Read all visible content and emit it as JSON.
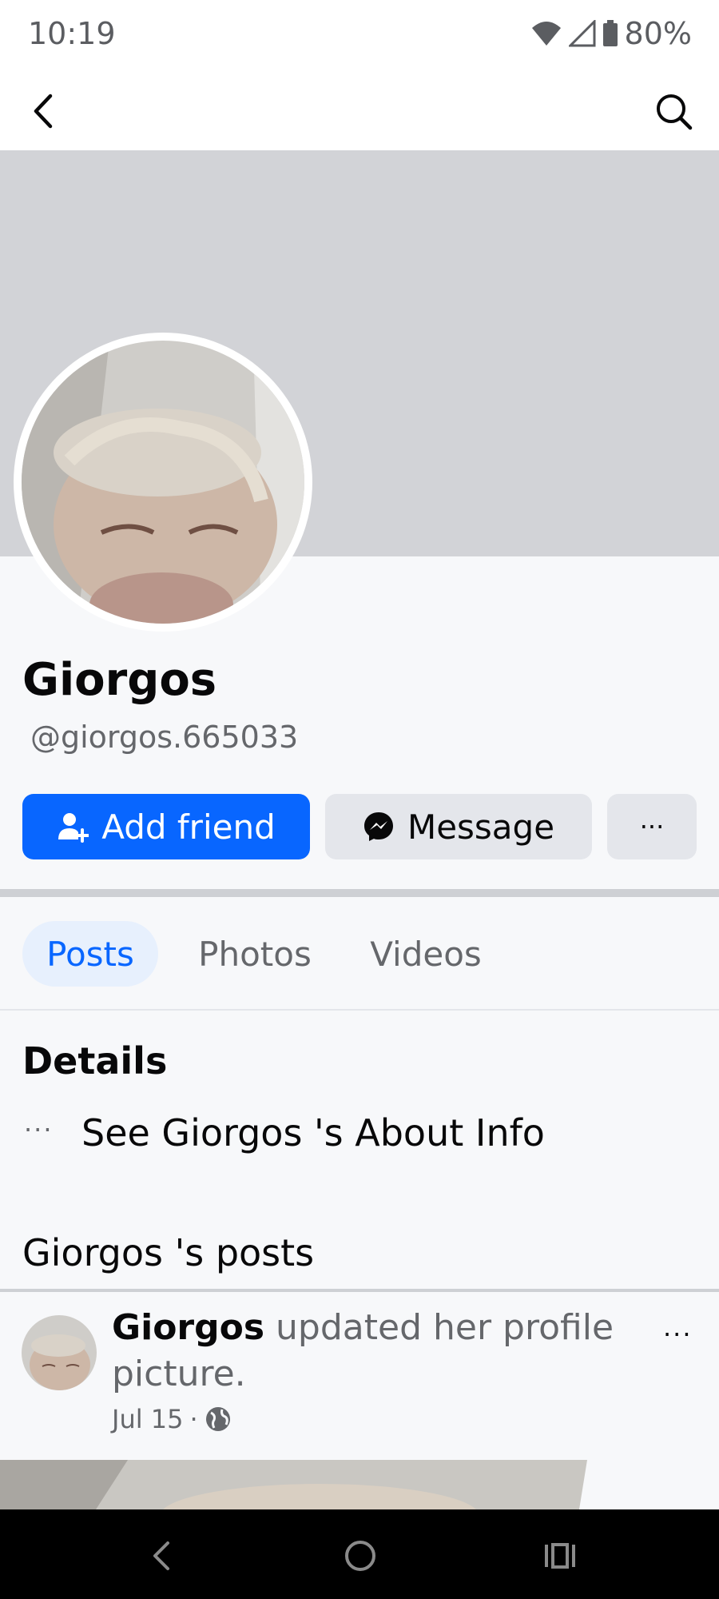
{
  "status_bar": {
    "time": "10:19",
    "battery": "80%"
  },
  "profile": {
    "name": "Giorgos",
    "handle": "@giorgos.665033"
  },
  "actions": {
    "add_friend": "Add friend",
    "message": "Message",
    "more": "···"
  },
  "tabs": [
    {
      "label": "Posts",
      "active": true
    },
    {
      "label": "Photos",
      "active": false
    },
    {
      "label": "Videos",
      "active": false
    }
  ],
  "details": {
    "title": "Details",
    "about_icon": "···",
    "about_text": "See Giorgos 's About Info"
  },
  "posts_section": {
    "title": "Giorgos 's posts"
  },
  "post": {
    "author": "Giorgos",
    "action": "updated her profile picture.",
    "date": "Jul 15",
    "separator": "·",
    "privacy_icon": "globe-icon",
    "more": "···"
  },
  "colors": {
    "accent": "#0866ff",
    "cover": "#d2d3d7",
    "secondary_button": "#e4e6eb",
    "tab_active_bg": "#e7f0fd"
  }
}
